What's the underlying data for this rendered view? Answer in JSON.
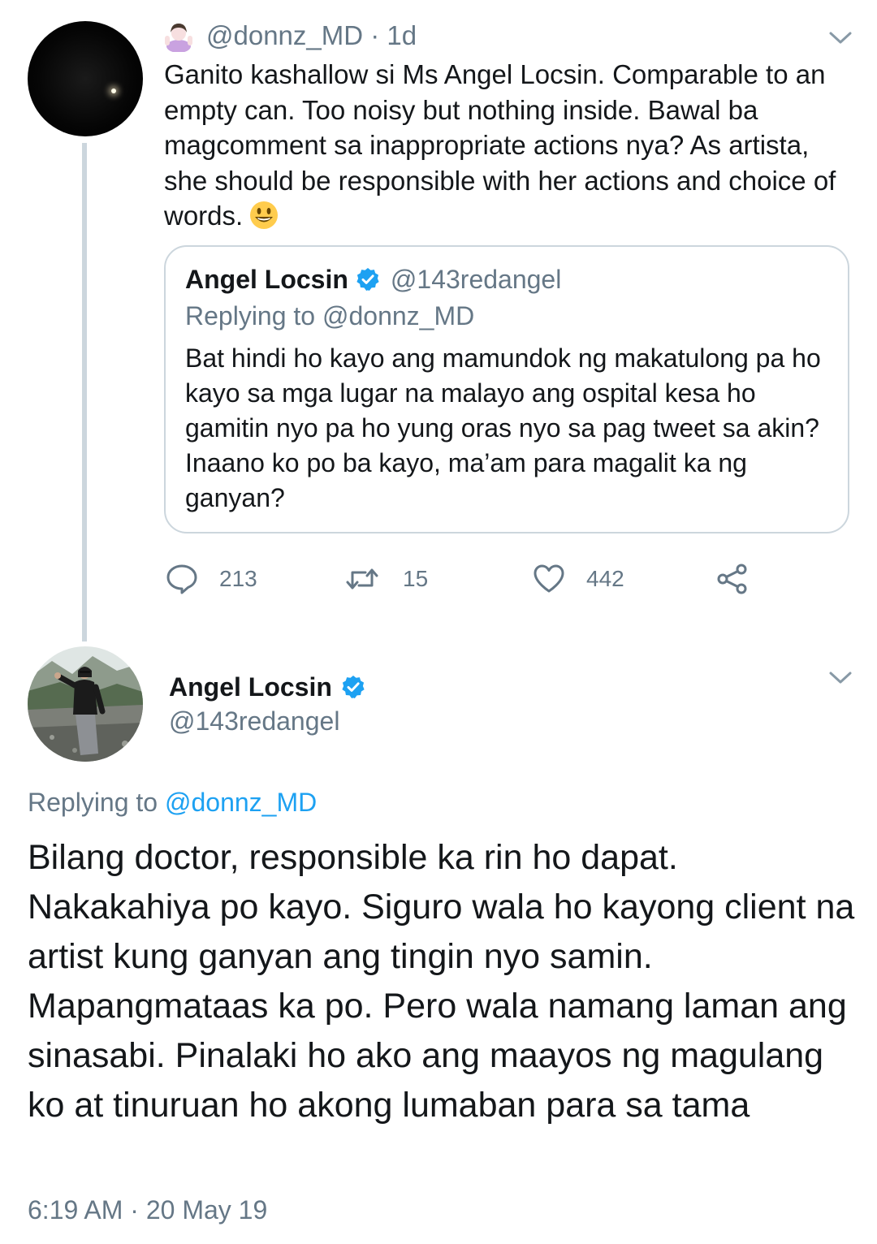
{
  "parent_tweet": {
    "avatar_icon": "dark-night-sky-avatar",
    "handle": "@donnz_MD",
    "time_separator": " · ",
    "age": "1d",
    "emoji_icon": "person-shrugging-emoji",
    "body": "Ganito kashallow si Ms Angel Locsin. Comparable to an empty can. Too noisy but nothing inside. Bawal ba magcomment sa inappropriate actions nya? As artista, she should be responsible with her actions and choice of words.",
    "body_emoji": "smiling-face-emoji",
    "quoted": {
      "name": "Angel Locsin",
      "handle": "@143redangel",
      "replying_prefix": "Replying to ",
      "replying_handle": "@donnz_MD",
      "body": "Bat hindi ho kayo ang mamundok ng makatulong pa ho kayo sa mga lugar na malayo ang ospital kesa ho gamitin nyo pa ho yung oras nyo sa pag tweet sa akin? Inaano ko po ba kayo, ma’am para magalit ka ng ganyan?"
    },
    "actions": {
      "replies": "213",
      "retweets": "15",
      "likes": "442"
    }
  },
  "main_tweet": {
    "avatar_icon": "profile-photo-avatar",
    "name": "Angel Locsin",
    "handle": "@143redangel",
    "replying_prefix": "Replying to ",
    "replying_handle": "@donnz_MD",
    "body": "Bilang doctor, responsible ka rin ho dapat. Nakakahiya po kayo. Siguro wala ho kayong client na artist kung ganyan ang tingin nyo samin. Mapangmataas ka po. Pero wala namang laman ang sinasabi. Pinalaki ho ako ang maayos ng magulang ko at tinuruan ho akong lumaban para sa tama",
    "timestamp": "6:19 AM · 20 May 19"
  },
  "colors": {
    "text_primary": "#14171a",
    "text_secondary": "#657786",
    "link": "#1da1f2",
    "border": "#ccd6dd",
    "verified_badge": "#1da1f2"
  }
}
